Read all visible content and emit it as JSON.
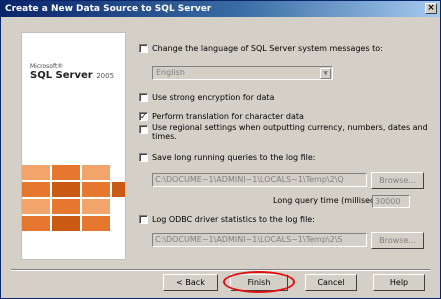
{
  "window": {
    "title": "Create a New Data Source to SQL Server",
    "close": "×"
  },
  "brand": {
    "vendor": "Microsoft®",
    "product": "SQL Server",
    "year": "2005"
  },
  "options": {
    "change_language": {
      "checked": false,
      "label": "Change the language of SQL Server system messages to:"
    },
    "language": {
      "value": "English"
    },
    "strong_encryption": {
      "checked": false,
      "label": "Use strong encryption for data"
    },
    "translation": {
      "checked": true,
      "label": "Perform translation for character data"
    },
    "regional_settings": {
      "checked": false,
      "label_line1": "Use regional settings when outputting currency, numbers, dates and",
      "label_line2": "times."
    },
    "long_queries": {
      "checked": false,
      "label": "Save long running queries to the log file:"
    },
    "long_queries_path": "C:\\DOCUME~1\\ADMINI~1\\LOCALS~1\\Temp\\2\\Q",
    "long_query_time": {
      "label": "Long query time (milliseconds):",
      "value": "30000"
    },
    "odbc_stats": {
      "checked": false,
      "label": "Log ODBC driver statistics to the log file:"
    },
    "odbc_stats_path": "C:\\DOCUME~1\\ADMINI~1\\LOCALS~1\\Temp\\2\\S",
    "browse_label": "Browse...",
    "browse2_label": "Browse..."
  },
  "buttons": {
    "back": "< Back",
    "finish": "Finish",
    "cancel": "Cancel",
    "help": "Help"
  },
  "colors": {
    "title_start": "#0a246a",
    "highlight": "#e01010",
    "brand_tile": "#e6772e"
  }
}
